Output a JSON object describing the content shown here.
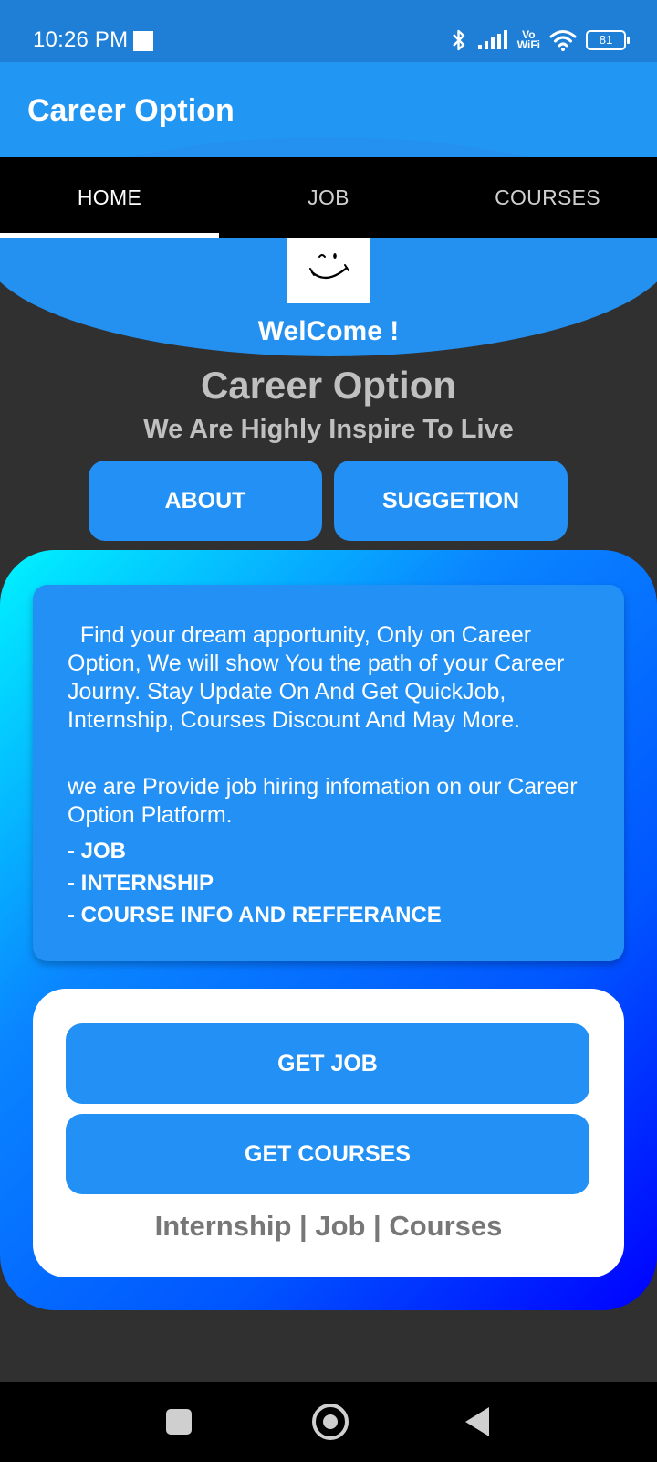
{
  "status_bar": {
    "time": "10:26 PM",
    "vowifi_top": "Vo",
    "vowifi_bottom": "WiFi",
    "battery": "81"
  },
  "app_bar": {
    "title": "Career Option"
  },
  "tabs": [
    {
      "label": "HOME",
      "active": true
    },
    {
      "label": "JOB",
      "active": false
    },
    {
      "label": "COURSES",
      "active": false
    }
  ],
  "hero": {
    "welcome": "WelCome !",
    "headline": "Career Option",
    "tagline": "We Are Highly Inspire To Live"
  },
  "buttons": {
    "about": "ABOUT",
    "suggestion": "SUGGETION"
  },
  "info": {
    "paragraph1": "  Find your dream apportunity, Only on Career Option, We will show You the path of your Career Journy. Stay Update On And Get QuickJob, Internship, Courses Discount And May More.",
    "paragraph2": "we are Provide job hiring infomation on our Career Option Platform.",
    "list": [
      "- JOB",
      "- INTERNSHIP",
      "- COURSE INFO AND REFFERANCE"
    ]
  },
  "actions": {
    "get_job": "GET JOB",
    "get_courses": "GET COURSES",
    "footer_links": "Internship | Job | Courses"
  },
  "colors": {
    "primary": "#2196f3",
    "button": "#2290f4",
    "background": "#303030",
    "gradient_start": "#00f3ff",
    "gradient_end": "#0000ff"
  },
  "icons": {
    "bluetooth": "bluetooth-icon",
    "signal": "signal-icon",
    "wifi": "wifi-icon",
    "battery": "battery-icon",
    "logo": "wink-smiley-icon",
    "nav_recents": "square-icon",
    "nav_home": "circle-icon",
    "nav_back": "triangle-back-icon"
  }
}
